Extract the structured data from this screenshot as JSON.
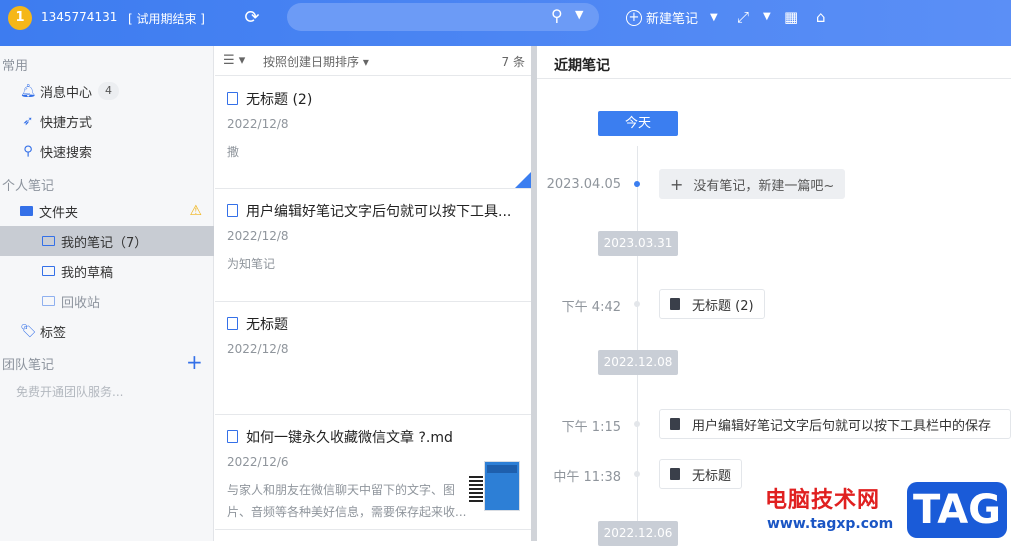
{
  "topbar": {
    "avatar_letter": "1",
    "account": "1345774131",
    "trial_status": "[ 试用期结束 ]",
    "new_note_label": "新建笔记",
    "search_placeholder": ""
  },
  "sidebar": {
    "section_common": "常用",
    "message_center": "消息中心",
    "message_count": "4",
    "shortcuts": "快捷方式",
    "quick_search": "快速搜索",
    "section_personal": "个人笔记",
    "folders": "文件夹",
    "my_notes": "我的笔记（7）",
    "my_drafts": "我的草稿",
    "recycle": "回收站",
    "tags": "标签",
    "section_team": "团队笔记",
    "free_team": "免费开通团队服务..."
  },
  "notelist": {
    "sort_label": "按照创建日期排序",
    "count": "7 条",
    "notes": [
      {
        "title": "无标题 (2)",
        "date": "2022/12/8",
        "snippet": "撒"
      },
      {
        "title": "用户编辑好笔记文字后句就可以按下工具...",
        "date": "2022/12/8",
        "snippet": "为知笔记"
      },
      {
        "title": "无标题",
        "date": "2022/12/8",
        "snippet": ""
      },
      {
        "title": "如何一键永久收藏微信文章 ?.md",
        "date": "2022/12/6",
        "snippet": "与家人和朋友在微信聊天中留下的文字、图片、音频等各种美好信息，需要保存起来收..."
      }
    ]
  },
  "main": {
    "header": "近期笔记",
    "today": "今天",
    "t1_date": "2023.04.05",
    "t1_card": "没有笔记，新建一篇吧~",
    "d1": "2023.03.31",
    "t2_time": "下午 4:42",
    "t2_card": "无标题 (2)",
    "d2": "2022.12.08",
    "t3_time": "下午 1:15",
    "t3_card": "用户编辑好笔记文字后句就可以按下工具栏中的保存",
    "t4_time": "中午 11:38",
    "t4_card": "无标题",
    "d3": "2022.12.06"
  },
  "watermark": {
    "site_name": "电脑技术网",
    "url": "www.tagxp.com",
    "tag": "TAG"
  },
  "colors": {
    "accent": "#3b7ef0",
    "avatar": "#f5b718",
    "warning": "#f1b51c"
  }
}
